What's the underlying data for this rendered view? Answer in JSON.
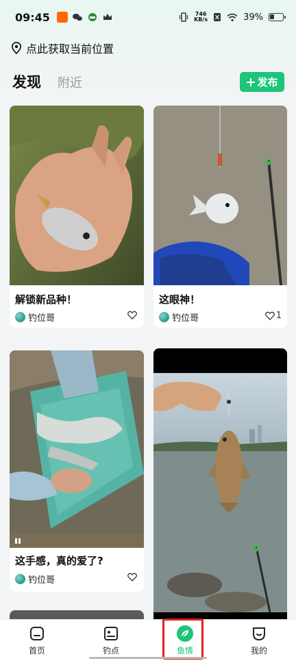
{
  "status_bar": {
    "time": "09:45",
    "network_speed_top": "746",
    "network_speed_bottom": "KB/s",
    "battery": "39%"
  },
  "location": {
    "label": "点此获取当前位置",
    "icon": "location-pin-icon"
  },
  "tabs": [
    {
      "label": "发现",
      "active": true
    },
    {
      "label": "附近",
      "active": false
    }
  ],
  "publish_button": {
    "label": "发布",
    "icon": "plus-icon"
  },
  "feed": [
    {
      "title": "解锁新品种！",
      "author": "钓位哥",
      "likes": ""
    },
    {
      "title": "这眼神！",
      "author": "钓位哥",
      "likes": "1"
    },
    {
      "title": "这手感，真的爱了?",
      "author": "钓位哥",
      "likes": ""
    },
    {
      "title": "",
      "author": "",
      "likes": ""
    }
  ],
  "bottom_nav": [
    {
      "label": "首页",
      "icon": "home-icon"
    },
    {
      "label": "钓点",
      "icon": "spot-icon"
    },
    {
      "label": "鱼情",
      "icon": "leaf-icon",
      "active": true
    },
    {
      "label": "我的",
      "icon": "profile-icon"
    }
  ],
  "colors": {
    "accent": "#1ec47a",
    "highlight": "#e02020"
  }
}
